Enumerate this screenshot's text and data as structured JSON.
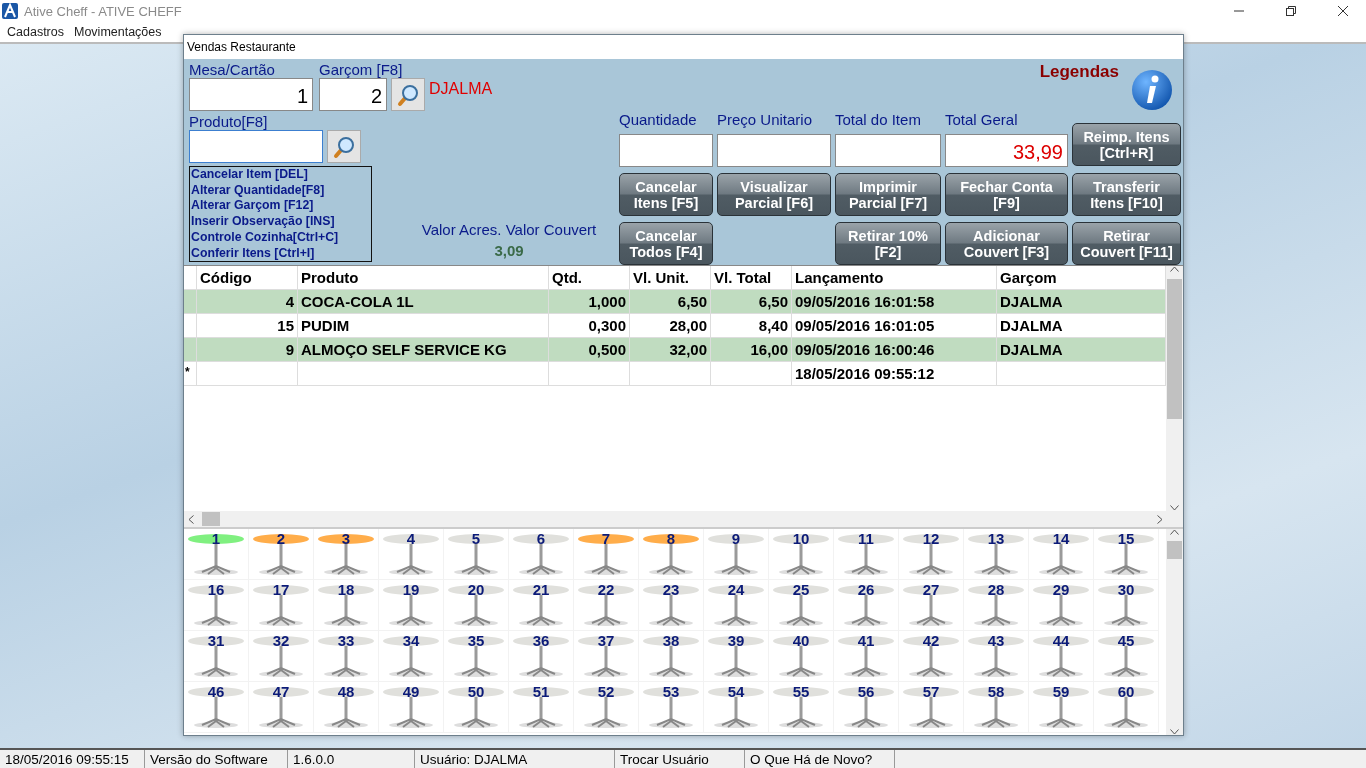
{
  "window": {
    "title": "Ative Cheff - ATIVE CHEFF"
  },
  "menu": [
    "Cadastros",
    "Movimentações"
  ],
  "dialog": {
    "title": "Vendas Restaurante",
    "mesa": {
      "label": "Mesa/Cartão",
      "value": "1"
    },
    "garcom": {
      "label": "Garçom [F8]",
      "value": "2",
      "name": "DJALMA"
    },
    "produto": {
      "label": "Produto[F8]"
    },
    "shortcuts": [
      "Cancelar Item [DEL]",
      "Alterar Quantidade[F8]",
      "Alterar Garçom [F12]",
      "Inserir Observação [INS]",
      "Controle Cozinha[Ctrl+C]",
      "Conferir Itens [Ctrl+I]"
    ],
    "valor_label": "Valor Acres. Valor Couvert",
    "valor": "3,09",
    "legend": "Legendas",
    "totals": [
      {
        "label": "Quantidade"
      },
      {
        "label": "Preço Unitario"
      },
      {
        "label": "Total do Item"
      },
      {
        "label": "Total Geral",
        "value": "33,99"
      }
    ],
    "reprint_button": [
      "Reimp. Itens",
      "[Ctrl+R]"
    ],
    "button_rows": [
      [
        [
          "Cancelar",
          "Itens [F5]"
        ],
        [
          "Visualizar",
          "Parcial [F6]"
        ],
        [
          "Imprimir",
          "Parcial [F7]"
        ],
        [
          "Fechar Conta",
          "[F9]"
        ],
        [
          "Transferir",
          "Itens [F10]"
        ]
      ],
      [
        [
          "Cancelar",
          "Todos [F4]"
        ],
        [
          "Retirar 10%",
          "[F2]"
        ],
        [
          "Adicionar",
          "Couvert [F3]"
        ],
        [
          "Retirar",
          "Couvert [F11]"
        ]
      ]
    ],
    "table": {
      "columns": [
        "Código",
        "Produto",
        "Qtd.",
        "Vl. Unit.",
        "Vl. Total",
        "Lançamento",
        "Garçom"
      ],
      "rows": [
        {
          "marker": "",
          "cells": [
            "4",
            "COCA-COLA 1L",
            "1,000",
            "6,50",
            "6,50",
            "09/05/2016 16:01:58",
            "DJALMA"
          ]
        },
        {
          "marker": "",
          "cells": [
            "15",
            "PUDIM",
            "0,300",
            "28,00",
            "8,40",
            "09/05/2016 16:01:05",
            "DJALMA"
          ]
        },
        {
          "marker": "",
          "cells": [
            "9",
            "ALMOÇO SELF SERVICE KG",
            "0,500",
            "32,00",
            "16,00",
            "09/05/2016 16:00:46",
            "DJALMA"
          ]
        },
        {
          "marker": "*",
          "cells": [
            "",
            "",
            "",
            "",
            "",
            "18/05/2016 09:55:12",
            ""
          ]
        }
      ]
    },
    "tables": [
      {
        "number": "1",
        "color": "#80f080"
      },
      {
        "number": "2",
        "color": "#ffad4a"
      },
      {
        "number": "3",
        "color": "#ffad4a"
      },
      {
        "number": "4",
        "color": "#e0e0dc"
      },
      {
        "number": "5",
        "color": "#e0e0dc"
      },
      {
        "number": "6",
        "color": "#e0e0dc"
      },
      {
        "number": "7",
        "color": "#ffad4a"
      },
      {
        "number": "8",
        "color": "#ffad4a"
      },
      {
        "number": "9",
        "color": "#e0e0dc"
      },
      {
        "number": "10",
        "color": "#e0e0dc"
      },
      {
        "number": "11",
        "color": "#e0e0dc"
      },
      {
        "number": "12",
        "color": "#e0e0dc"
      },
      {
        "number": "13",
        "color": "#e0e0dc"
      },
      {
        "number": "14",
        "color": "#e0e0dc"
      },
      {
        "number": "15",
        "color": "#e0e0dc"
      },
      {
        "number": "16",
        "color": "#e0e0dc"
      },
      {
        "number": "17",
        "color": "#e0e0dc"
      },
      {
        "number": "18",
        "color": "#e0e0dc"
      },
      {
        "number": "19",
        "color": "#e0e0dc"
      },
      {
        "number": "20",
        "color": "#e0e0dc"
      },
      {
        "number": "21",
        "color": "#e0e0dc"
      },
      {
        "number": "22",
        "color": "#e0e0dc"
      },
      {
        "number": "23",
        "color": "#e0e0dc"
      },
      {
        "number": "24",
        "color": "#e0e0dc"
      },
      {
        "number": "25",
        "color": "#e0e0dc"
      },
      {
        "number": "26",
        "color": "#e0e0dc"
      },
      {
        "number": "27",
        "color": "#e0e0dc"
      },
      {
        "number": "28",
        "color": "#e0e0dc"
      },
      {
        "number": "29",
        "color": "#e0e0dc"
      },
      {
        "number": "30",
        "color": "#e0e0dc"
      },
      {
        "number": "31",
        "color": "#e0e0dc"
      },
      {
        "number": "32",
        "color": "#e0e0dc"
      },
      {
        "number": "33",
        "color": "#e0e0dc"
      },
      {
        "number": "34",
        "color": "#e0e0dc"
      },
      {
        "number": "35",
        "color": "#e0e0dc"
      },
      {
        "number": "36",
        "color": "#e0e0dc"
      },
      {
        "number": "37",
        "color": "#e0e0dc"
      },
      {
        "number": "38",
        "color": "#e0e0dc"
      },
      {
        "number": "39",
        "color": "#e0e0dc"
      },
      {
        "number": "40",
        "color": "#e0e0dc"
      },
      {
        "number": "41",
        "color": "#e0e0dc"
      },
      {
        "number": "42",
        "color": "#e0e0dc"
      },
      {
        "number": "43",
        "color": "#e0e0dc"
      },
      {
        "number": "44",
        "color": "#e0e0dc"
      },
      {
        "number": "45",
        "color": "#e0e0dc"
      },
      {
        "number": "46",
        "color": "#e0e0dc"
      },
      {
        "number": "47",
        "color": "#e0e0dc"
      },
      {
        "number": "48",
        "color": "#e0e0dc"
      },
      {
        "number": "49",
        "color": "#e0e0dc"
      },
      {
        "number": "50",
        "color": "#e0e0dc"
      },
      {
        "number": "51",
        "color": "#e0e0dc"
      },
      {
        "number": "52",
        "color": "#e0e0dc"
      },
      {
        "number": "53",
        "color": "#e0e0dc"
      },
      {
        "number": "54",
        "color": "#e0e0dc"
      },
      {
        "number": "55",
        "color": "#e0e0dc"
      },
      {
        "number": "56",
        "color": "#e0e0dc"
      },
      {
        "number": "57",
        "color": "#e0e0dc"
      },
      {
        "number": "58",
        "color": "#e0e0dc"
      },
      {
        "number": "59",
        "color": "#e0e0dc"
      },
      {
        "number": "60",
        "color": "#e0e0dc"
      }
    ]
  },
  "status_bar": [
    "18/05/2016 09:55:15",
    "Versão do Software",
    "1.6.0.0",
    "Usuário: DJALMA",
    "Trocar Usuário",
    "O Que Há de Novo?"
  ]
}
